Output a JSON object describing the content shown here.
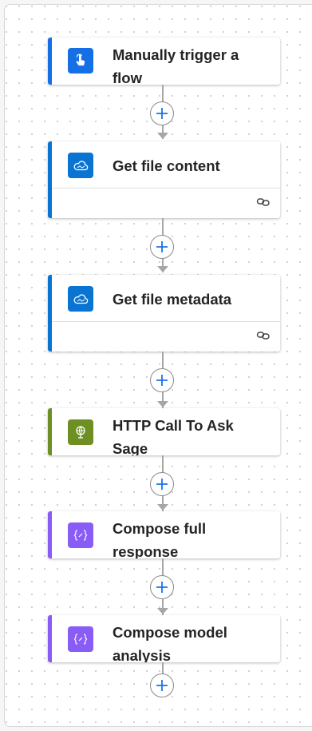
{
  "flow": {
    "steps": [
      {
        "title": "Manually trigger a flow",
        "icon": "touch-hand-icon",
        "accent": "#1570e6",
        "icon_bg": "#1570e6"
      },
      {
        "title": "Get file content",
        "icon": "onedrive-cloud-icon",
        "accent": "#0a74d3",
        "icon_bg": "#0a74d3"
      },
      {
        "title": "Get file metadata",
        "icon": "onedrive-cloud-icon",
        "accent": "#0a74d3",
        "icon_bg": "#0a74d3"
      },
      {
        "title": "HTTP Call To Ask Sage",
        "icon": "http-globe-icon",
        "accent": "#6e8f23",
        "icon_bg": "#6e8f23"
      },
      {
        "title": "Compose full response",
        "icon": "compose-braces-icon",
        "accent": "#8a5cf6",
        "icon_bg": "#8a5cf6"
      },
      {
        "title": "Compose model analysis",
        "icon": "compose-braces-icon",
        "accent": "#8a5cf6",
        "icon_bg": "#8a5cf6"
      }
    ],
    "add_button_label": "+"
  }
}
